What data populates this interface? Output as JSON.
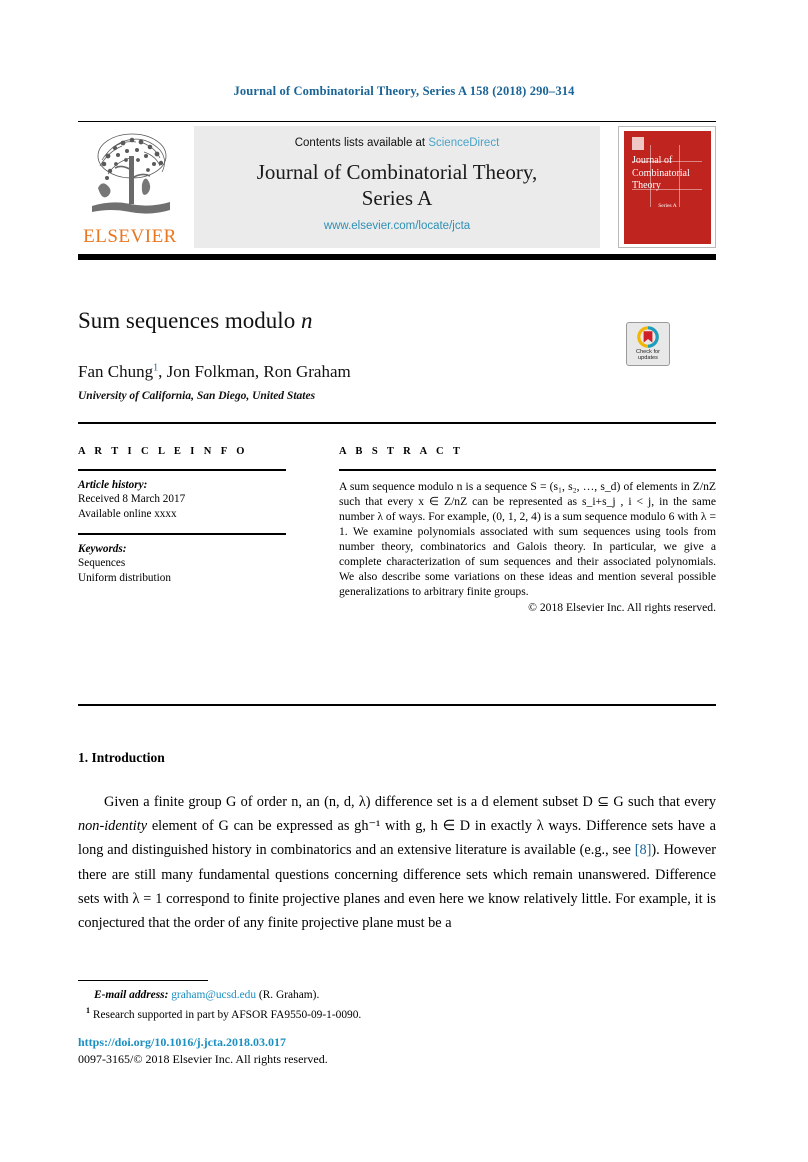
{
  "running_head": "Journal of Combinatorial Theory, Series A 158 (2018) 290–314",
  "masthead": {
    "contents_prefix": "Contents lists available at ",
    "sciencedirect": "ScienceDirect",
    "journal_line1": "Journal of Combinatorial Theory,",
    "journal_line2": "Series A",
    "journal_url": "www.elsevier.com/locate/jcta",
    "publisher_wordmark": "ELSEVIER",
    "cover": {
      "title": "Journal of Combinatorial Theory",
      "series": "Series A"
    }
  },
  "article": {
    "title_main": "Sum sequences modulo ",
    "title_italic": "n",
    "authors": "Fan Chung",
    "author_footnote_marker": "1",
    "authors_rest": ", Jon Folkman, Ron Graham",
    "affiliation": "University of California, San Diego, United States"
  },
  "crossmark": {
    "line1": "Check for",
    "line2": "updates"
  },
  "info": {
    "heading": "A R T I C L E   I N F O",
    "history_label": "Article history:",
    "history_received": "Received 8 March 2017",
    "history_online": "Available online xxxx",
    "keywords_label": "Keywords:",
    "keyword_1": "Sequences",
    "keyword_2": "Uniform distribution"
  },
  "abstract": {
    "heading": "A B S T R A C T",
    "body": "A sum sequence modulo n is a sequence S = (s₁, s₂, …, s_d) of elements in Z/nZ such that every x ∈ Z/nZ can be represented as s_i+s_j , i < j, in the same number λ of ways. For example, (0, 1, 2, 4) is a sum sequence modulo 6 with λ = 1. We examine polynomials associated with sum sequences using tools from number theory, combinatorics and Galois theory. In particular, we give a complete characterization of sum sequences and their associated polynomials. We also describe some variations on these ideas and mention several possible generalizations to arbitrary finite groups.",
    "copyright": "© 2018 Elsevier Inc. All rights reserved."
  },
  "section": {
    "heading": "1. Introduction",
    "paragraph_part1": "Given a finite group G of order n, an (n, d, λ) difference set is a d element subset D ⊆ G such that every ",
    "paragraph_italic": "non-identity",
    "paragraph_part2": " element of G can be expressed as gh⁻¹ with g, h ∈ D in exactly λ ways. Difference sets have a long and distinguished history in combinatorics and an extensive literature is available (e.g., see ",
    "citation": "[8]",
    "paragraph_part3": "). However there are still many fundamental questions concerning difference sets which remain unanswered. Difference sets with λ = 1 correspond to finite projective planes and even here we know relatively little. For example, it is conjectured that the order of any finite projective plane must be a"
  },
  "footnotes": {
    "email_label": "E-mail address:",
    "email_value": "graham@ucsd.edu",
    "email_suffix": " (R. Graham).",
    "note_marker": "1",
    "note_text": "Research supported in part by AFSOR FA9550-09-1-0090.",
    "doi": "https://doi.org/10.1016/j.jcta.2018.03.017",
    "issn": "0097-3165/© 2018 Elsevier Inc. All rights reserved."
  }
}
